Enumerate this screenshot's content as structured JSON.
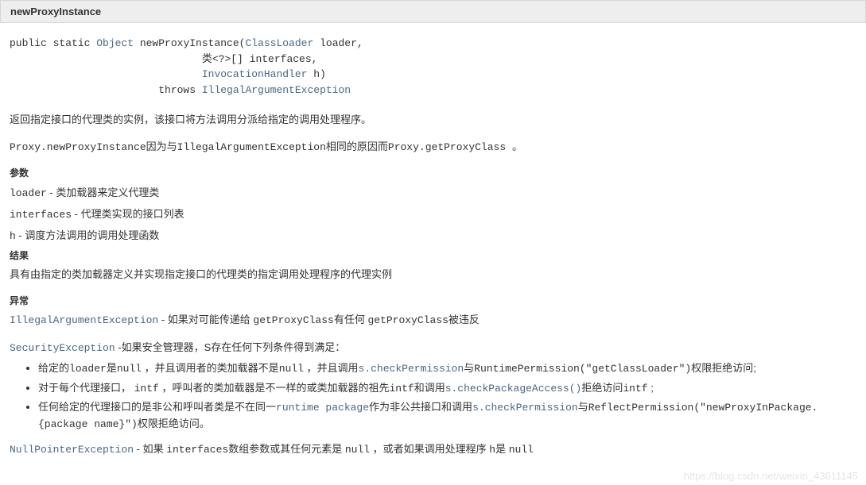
{
  "header": {
    "title": "newProxyInstance"
  },
  "signature": {
    "modifiers": "public static ",
    "returnType": "Object",
    "methodName": " newProxyInstance(",
    "p1Type": "ClassLoader",
    "p1Name": " loader,",
    "indent": "                               ",
    "p2": "类<?>[] interfaces,",
    "p3Type": "InvocationHandler",
    "p3Name": " h)",
    "throwsIndent": "                        throws ",
    "throwsType": "IllegalArgumentException"
  },
  "desc": "返回指定接口的代理类的实例，该接口将方法调用分派给指定的调用处理程序。",
  "note": {
    "a": "Proxy.newProxyInstance",
    "b": "因为与",
    "c": "IllegalArgumentException",
    "d": "相同的原因而",
    "e": "Proxy.getProxyClass ",
    "f": "。"
  },
  "labels": {
    "params": "参数",
    "result": "结果",
    "throws": "异常"
  },
  "params": {
    "loader_code": "loader",
    "loader_txt": " - 类加载器来定义代理类",
    "interfaces_code": "interfaces",
    "interfaces_txt": " - 代理类实现的接口列表",
    "h_code": "h",
    "h_txt": " - 调度方法调用的调用处理函数"
  },
  "result": "具有由指定的类加载器定义并实现指定接口的代理类的指定调用处理程序的代理实例",
  "throws": {
    "iae_link": "IllegalArgumentException",
    "iae_txt1": " - 如果对可能传递给 ",
    "iae_code1": "getProxyClass",
    "iae_txt2": "有任何 ",
    "iae_code2": "getProxyClass",
    "iae_txt3": "被违反",
    "se_link": "SecurityException",
    "se_prefix": " -如果安全管理器，S存在任何下列条件得到满足：",
    "li1_a": "给定的",
    "li1_b": "loader",
    "li1_c": "是",
    "li1_d": "null",
    "li1_e": " ，并且调用者的类加载器不是",
    "li1_f": "null",
    "li1_g": " ，并且调用",
    "li1_link1": "s.checkPermission",
    "li1_h": "与",
    "li1_i": "RuntimePermission(\"getClassLoader\")",
    "li1_j": "权限拒绝访问;",
    "li2_a": "对于每个代理接口， ",
    "li2_b": "intf",
    "li2_c": " ，呼叫者的类加载器是不一样的或类加载器的祖先",
    "li2_d": "intf",
    "li2_e": "和调用",
    "li2_link": "s.checkPackageAccess()",
    "li2_f": "拒绝访问",
    "li2_g": "intf",
    "li2_h": " ;",
    "li3_a": "任何给定的代理接口的是非公和呼叫者类是不在同一",
    "li3_link1": "runtime package",
    "li3_b": "作为非公共接口和调用",
    "li3_link2": "s.checkPermission",
    "li3_c": "与",
    "li3_d": "ReflectPermission(\"newProxyInPackage.{package name}\")",
    "li3_e": "权限拒绝访问。",
    "npe_link": "NullPointerException",
    "npe_a": " - 如果 ",
    "npe_b": "interfaces",
    "npe_c": "数组参数或其任何元素是 ",
    "npe_d": "null",
    "npe_e": " ，或者如果调用处理程序 ",
    "npe_f": "h",
    "npe_g": "是 ",
    "npe_h": "null"
  },
  "watermark": "https://blog.csdn.net/weixin_43611145"
}
